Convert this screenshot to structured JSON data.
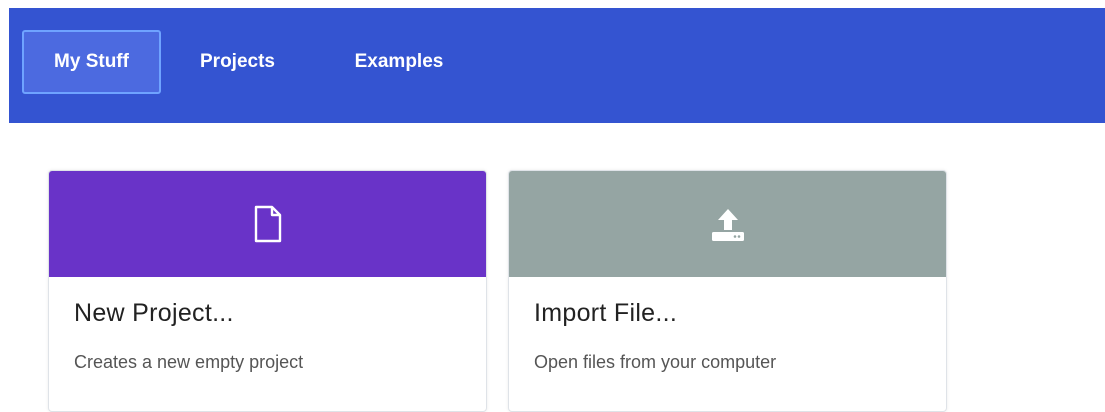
{
  "nav": {
    "tabs": [
      {
        "label": "My Stuff",
        "active": true
      },
      {
        "label": "Projects",
        "active": false
      },
      {
        "label": "Examples",
        "active": false
      }
    ]
  },
  "cards": {
    "new_project": {
      "icon": "file-icon",
      "title": "New Project...",
      "description": "Creates a new empty project"
    },
    "import_file": {
      "icon": "upload-icon",
      "title": "Import File...",
      "description": "Open files from your computer"
    }
  },
  "colors": {
    "topbar": "#3454d1",
    "active_tab_bg": "#4c6ae0",
    "active_tab_border": "#6fa3ff",
    "new_project_header": "#6933c8",
    "import_file_header": "#95a5a3"
  }
}
